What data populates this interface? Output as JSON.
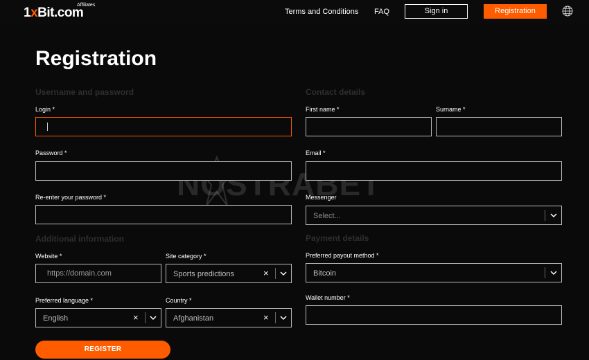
{
  "header": {
    "logo_text_1": "1",
    "logo_text_x": "x",
    "logo_text_2": "Bit.com",
    "logo_affiliates": "Affiliates",
    "nav_terms": "Terms and Conditions",
    "nav_faq": "FAQ",
    "signin_label": "Sign in",
    "registration_label": "Registration",
    "globe_icon": "globe-icon"
  },
  "page": {
    "title": "Registration"
  },
  "sections": {
    "username_password": "Username and password",
    "contact_details": "Contact details",
    "additional_information": "Additional information",
    "payment_details": "Payment details"
  },
  "fields": {
    "login": {
      "label": "Login *",
      "value": ""
    },
    "password": {
      "label": "Password *",
      "value": ""
    },
    "reenter_password": {
      "label": "Re-enter your password *",
      "value": ""
    },
    "first_name": {
      "label": "First name *",
      "value": ""
    },
    "surname": {
      "label": "Surname *",
      "value": ""
    },
    "email": {
      "label": "Email *",
      "value": ""
    },
    "messenger": {
      "label": "Messenger",
      "placeholder": "Select..."
    },
    "website": {
      "label": "Website *",
      "placeholder": "https://domain.com"
    },
    "site_category": {
      "label": "Site category *",
      "value": "Sports predictions"
    },
    "preferred_language": {
      "label": "Preferred language *",
      "value": "English"
    },
    "country": {
      "label": "Country *",
      "value": "Afghanistan"
    },
    "payout_method": {
      "label": "Preferred payout method *",
      "value": "Bitcoin"
    },
    "wallet_number": {
      "label": "Wallet number *",
      "value": ""
    }
  },
  "buttons": {
    "register": "REGISTER",
    "clear_glyph": "×"
  },
  "watermark": {
    "text": "NOSTRABET"
  },
  "colors": {
    "accent": "#ff5c00",
    "background": "#0a0a0a",
    "border": "#bdbdbd"
  }
}
